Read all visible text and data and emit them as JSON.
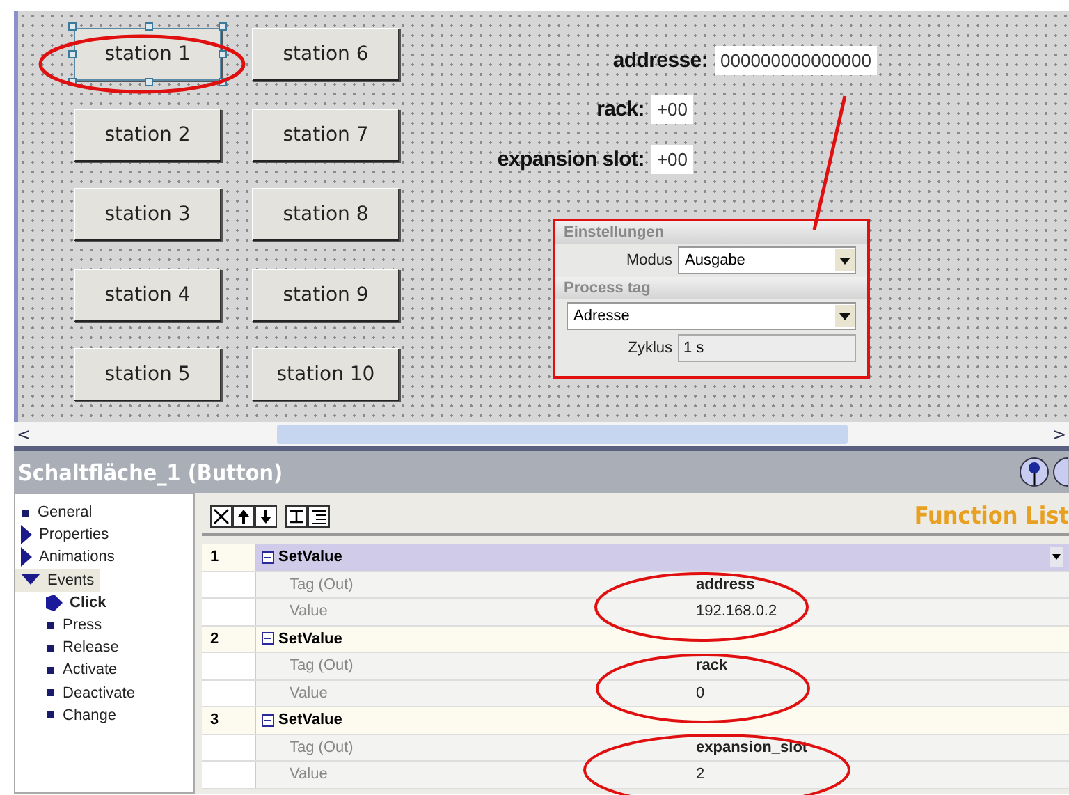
{
  "canvas": {
    "buttons": [
      {
        "label": "station 1",
        "selected": true
      },
      {
        "label": "station 2",
        "selected": false
      },
      {
        "label": "station 3",
        "selected": false
      },
      {
        "label": "station 4",
        "selected": false
      },
      {
        "label": "station 5",
        "selected": false
      },
      {
        "label": "station 6",
        "selected": false
      },
      {
        "label": "station 7",
        "selected": false
      },
      {
        "label": "station 8",
        "selected": false
      },
      {
        "label": "station 9",
        "selected": false
      },
      {
        "label": "station 10",
        "selected": false
      }
    ],
    "fields": [
      {
        "label": "addresse:",
        "value": "000000000000000"
      },
      {
        "label": "rack:",
        "value": "+00"
      },
      {
        "label": "expansion slot:",
        "value": "+00"
      }
    ],
    "io_panel": {
      "sections": [
        {
          "title": "Einstellungen",
          "rows": [
            {
              "kind": "dropdown",
              "label": "Modus",
              "value": "Ausgabe"
            }
          ]
        },
        {
          "title": "Process tag",
          "rows": [
            {
              "kind": "dropdown",
              "value": "Adresse"
            },
            {
              "kind": "field",
              "label": "Zyklus",
              "value": "1 s"
            }
          ]
        }
      ]
    }
  },
  "scrollbar": {
    "left": "<",
    "right": ">"
  },
  "panel": {
    "title": "Schaltfläche_1 (Button)",
    "tree": [
      {
        "label": "General",
        "kind": "leaf"
      },
      {
        "label": "Properties",
        "kind": "group",
        "expanded": false
      },
      {
        "label": "Animations",
        "kind": "group",
        "expanded": false
      },
      {
        "label": "Events",
        "kind": "group",
        "expanded": true,
        "children": [
          {
            "label": "Click",
            "selected": true
          },
          {
            "label": "Press",
            "selected": false
          },
          {
            "label": "Release",
            "selected": false
          },
          {
            "label": "Activate",
            "selected": false
          },
          {
            "label": "Deactivate",
            "selected": false
          },
          {
            "label": "Change",
            "selected": false
          }
        ]
      }
    ],
    "function_list": {
      "title": "Function List",
      "rows": [
        {
          "number": "1",
          "name": "SetValue",
          "selected": true,
          "params": [
            {
              "label": "Tag (Out)",
              "value": "address"
            },
            {
              "label": "Value",
              "value": "192.168.0.2"
            }
          ]
        },
        {
          "number": "2",
          "name": "SetValue",
          "selected": false,
          "params": [
            {
              "label": "Tag (Out)",
              "value": "rack"
            },
            {
              "label": "Value",
              "value": "0"
            }
          ]
        },
        {
          "number": "3",
          "name": "SetValue",
          "selected": false,
          "params": [
            {
              "label": "Tag (Out)",
              "value": "expansion_slot"
            },
            {
              "label": "Value",
              "value": "2"
            }
          ]
        }
      ]
    }
  }
}
